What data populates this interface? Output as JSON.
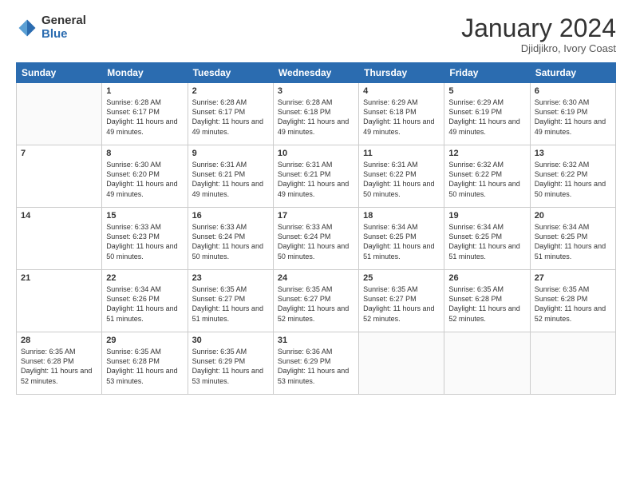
{
  "logo": {
    "general": "General",
    "blue": "Blue"
  },
  "header": {
    "month": "January 2024",
    "location": "Djidjikro, Ivory Coast"
  },
  "weekdays": [
    "Sunday",
    "Monday",
    "Tuesday",
    "Wednesday",
    "Thursday",
    "Friday",
    "Saturday"
  ],
  "weeks": [
    [
      {
        "day": "",
        "content": ""
      },
      {
        "day": "1",
        "content": "Sunrise: 6:28 AM\nSunset: 6:17 PM\nDaylight: 11 hours and 49 minutes."
      },
      {
        "day": "2",
        "content": "Sunrise: 6:28 AM\nSunset: 6:17 PM\nDaylight: 11 hours and 49 minutes."
      },
      {
        "day": "3",
        "content": "Sunrise: 6:28 AM\nSunset: 6:18 PM\nDaylight: 11 hours and 49 minutes."
      },
      {
        "day": "4",
        "content": "Sunrise: 6:29 AM\nSunset: 6:18 PM\nDaylight: 11 hours and 49 minutes."
      },
      {
        "day": "5",
        "content": "Sunrise: 6:29 AM\nSunset: 6:19 PM\nDaylight: 11 hours and 49 minutes."
      },
      {
        "day": "6",
        "content": "Sunrise: 6:30 AM\nSunset: 6:19 PM\nDaylight: 11 hours and 49 minutes."
      }
    ],
    [
      {
        "day": "7",
        "content": ""
      },
      {
        "day": "8",
        "content": "Sunrise: 6:30 AM\nSunset: 6:20 PM\nDaylight: 11 hours and 49 minutes."
      },
      {
        "day": "9",
        "content": "Sunrise: 6:31 AM\nSunset: 6:21 PM\nDaylight: 11 hours and 49 minutes."
      },
      {
        "day": "10",
        "content": "Sunrise: 6:31 AM\nSunset: 6:21 PM\nDaylight: 11 hours and 49 minutes."
      },
      {
        "day": "11",
        "content": "Sunrise: 6:31 AM\nSunset: 6:22 PM\nDaylight: 11 hours and 50 minutes."
      },
      {
        "day": "12",
        "content": "Sunrise: 6:32 AM\nSunset: 6:22 PM\nDaylight: 11 hours and 50 minutes."
      },
      {
        "day": "13",
        "content": "Sunrise: 6:32 AM\nSunset: 6:22 PM\nDaylight: 11 hours and 50 minutes."
      }
    ],
    [
      {
        "day": "14",
        "content": ""
      },
      {
        "day": "15",
        "content": "Sunrise: 6:33 AM\nSunset: 6:23 PM\nDaylight: 11 hours and 50 minutes."
      },
      {
        "day": "16",
        "content": "Sunrise: 6:33 AM\nSunset: 6:24 PM\nDaylight: 11 hours and 50 minutes."
      },
      {
        "day": "17",
        "content": "Sunrise: 6:33 AM\nSunset: 6:24 PM\nDaylight: 11 hours and 50 minutes."
      },
      {
        "day": "18",
        "content": "Sunrise: 6:34 AM\nSunset: 6:25 PM\nDaylight: 11 hours and 51 minutes."
      },
      {
        "day": "19",
        "content": "Sunrise: 6:34 AM\nSunset: 6:25 PM\nDaylight: 11 hours and 51 minutes."
      },
      {
        "day": "20",
        "content": "Sunrise: 6:34 AM\nSunset: 6:25 PM\nDaylight: 11 hours and 51 minutes."
      }
    ],
    [
      {
        "day": "21",
        "content": ""
      },
      {
        "day": "22",
        "content": "Sunrise: 6:34 AM\nSunset: 6:26 PM\nDaylight: 11 hours and 51 minutes."
      },
      {
        "day": "23",
        "content": "Sunrise: 6:35 AM\nSunset: 6:27 PM\nDaylight: 11 hours and 51 minutes."
      },
      {
        "day": "24",
        "content": "Sunrise: 6:35 AM\nSunset: 6:27 PM\nDaylight: 11 hours and 52 minutes."
      },
      {
        "day": "25",
        "content": "Sunrise: 6:35 AM\nSunset: 6:27 PM\nDaylight: 11 hours and 52 minutes."
      },
      {
        "day": "26",
        "content": "Sunrise: 6:35 AM\nSunset: 6:28 PM\nDaylight: 11 hours and 52 minutes."
      },
      {
        "day": "27",
        "content": "Sunrise: 6:35 AM\nSunset: 6:28 PM\nDaylight: 11 hours and 52 minutes."
      }
    ],
    [
      {
        "day": "28",
        "content": "Sunrise: 6:35 AM\nSunset: 6:28 PM\nDaylight: 11 hours and 52 minutes."
      },
      {
        "day": "29",
        "content": "Sunrise: 6:35 AM\nSunset: 6:28 PM\nDaylight: 11 hours and 53 minutes."
      },
      {
        "day": "30",
        "content": "Sunrise: 6:35 AM\nSunset: 6:29 PM\nDaylight: 11 hours and 53 minutes."
      },
      {
        "day": "31",
        "content": "Sunrise: 6:36 AM\nSunset: 6:29 PM\nDaylight: 11 hours and 53 minutes."
      },
      {
        "day": "",
        "content": ""
      },
      {
        "day": "",
        "content": ""
      },
      {
        "day": "",
        "content": ""
      }
    ]
  ]
}
